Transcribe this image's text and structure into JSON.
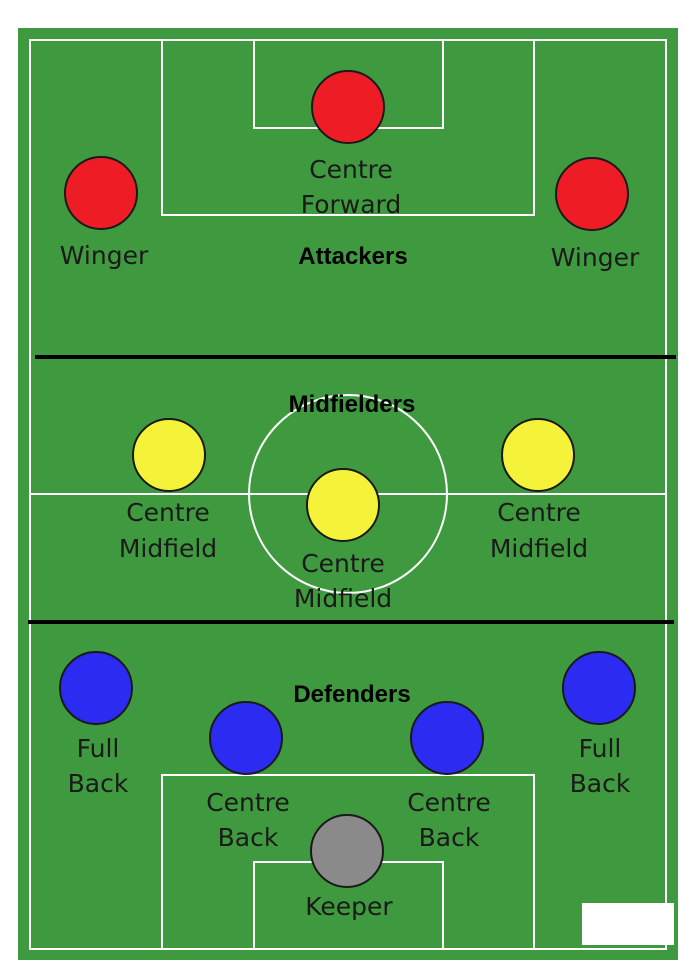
{
  "colors": {
    "pitch": "#3f9a3f",
    "lines": "#ffffff",
    "divider": "#000000",
    "attacker": "#ee1c25",
    "midfielder": "#f5f23a",
    "defender": "#2b2bf2",
    "keeper": "#8a8a8a",
    "outline": "#1a1a1a"
  },
  "zones": {
    "attackers": "Attackers",
    "midfielders": "Midfielders",
    "defenders": "Defenders"
  },
  "players": {
    "centre_forward": {
      "line1": "Centre",
      "line2": "Forward",
      "group": "attacker"
    },
    "winger_left": {
      "line1": "Winger",
      "line2": "",
      "group": "attacker"
    },
    "winger_right": {
      "line1": "Winger",
      "line2": "",
      "group": "attacker"
    },
    "centre_mid_left": {
      "line1": "Centre",
      "line2": "Midfield",
      "group": "midfielder"
    },
    "centre_mid_centre": {
      "line1": "Centre",
      "line2": "Midfield",
      "group": "midfielder"
    },
    "centre_mid_right": {
      "line1": "Centre",
      "line2": "Midfield",
      "group": "midfielder"
    },
    "full_back_left": {
      "line1": "Full",
      "line2": "Back",
      "group": "defender"
    },
    "full_back_right": {
      "line1": "Full",
      "line2": "Back",
      "group": "defender"
    },
    "centre_back_left": {
      "line1": "Centre",
      "line2": "Back",
      "group": "defender"
    },
    "centre_back_right": {
      "line1": "Centre",
      "line2": "Back",
      "group": "defender"
    },
    "keeper": {
      "line1": "Keeper",
      "line2": "",
      "group": "keeper"
    }
  }
}
